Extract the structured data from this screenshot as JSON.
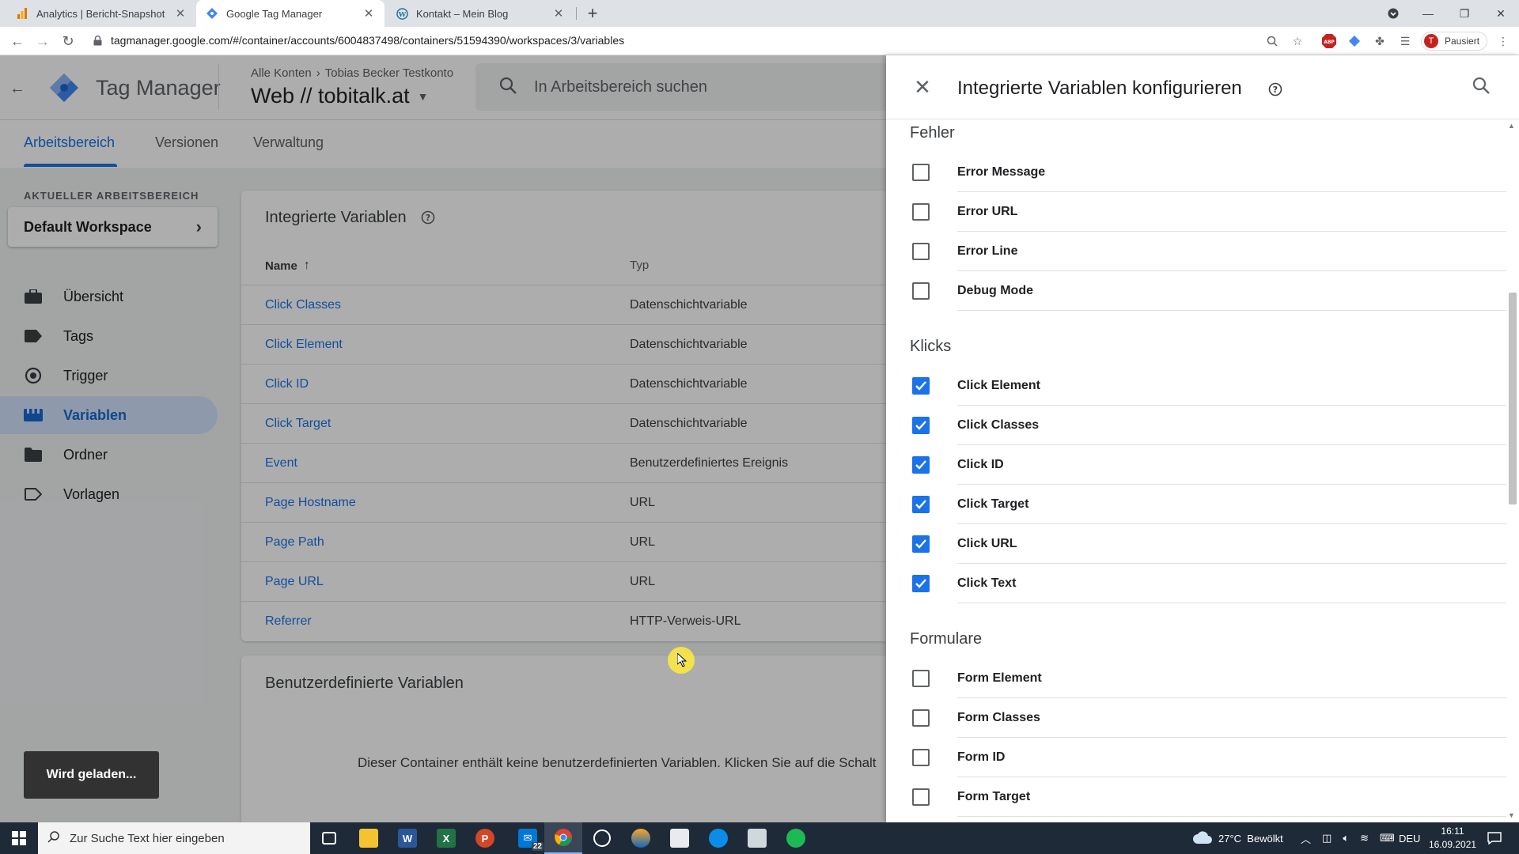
{
  "browser": {
    "tabs": [
      {
        "title": "Analytics | Bericht-Snapshot",
        "icon": "analytics-icon",
        "active": false
      },
      {
        "title": "Google Tag Manager",
        "icon": "gtm-icon",
        "active": true
      },
      {
        "title": "Kontakt – Mein Blog",
        "icon": "wordpress-icon",
        "active": false
      }
    ],
    "url": "tagmanager.google.com/#/container/accounts/6004837498/containers/51594390/workspaces/3/variables",
    "profile_label": "Pausiert",
    "profile_initial": "T"
  },
  "header": {
    "product": "Tag Manager",
    "breadcrumb_all": "Alle Konten",
    "breadcrumb_account": "Tobias Becker Testkonto",
    "container": "Web // tobitalk.at",
    "search_placeholder": "In Arbeitsbereich suchen"
  },
  "top_tabs": [
    "Arbeitsbereich",
    "Versionen",
    "Verwaltung"
  ],
  "workspace": {
    "label": "AKTUELLER ARBEITSBEREICH",
    "name": "Default Workspace"
  },
  "nav": [
    {
      "label": "Übersicht",
      "icon": "briefcase-icon",
      "active": false
    },
    {
      "label": "Tags",
      "icon": "tag-icon",
      "active": false
    },
    {
      "label": "Trigger",
      "icon": "trigger-icon",
      "active": false
    },
    {
      "label": "Variablen",
      "icon": "variables-icon",
      "active": true
    },
    {
      "label": "Ordner",
      "icon": "folder-icon",
      "active": false
    },
    {
      "label": "Vorlagen",
      "icon": "template-icon",
      "active": false
    }
  ],
  "builtin_card": {
    "title": "Integrierte Variablen",
    "col_name": "Name",
    "col_type": "Typ",
    "rows": [
      {
        "name": "Click Classes",
        "type": "Datenschichtvariable"
      },
      {
        "name": "Click Element",
        "type": "Datenschichtvariable"
      },
      {
        "name": "Click ID",
        "type": "Datenschichtvariable"
      },
      {
        "name": "Click Target",
        "type": "Datenschichtvariable"
      },
      {
        "name": "Event",
        "type": "Benutzerdefiniertes Ereignis"
      },
      {
        "name": "Page Hostname",
        "type": "URL"
      },
      {
        "name": "Page Path",
        "type": "URL"
      },
      {
        "name": "Page URL",
        "type": "URL"
      },
      {
        "name": "Referrer",
        "type": "HTTP-Verweis-URL"
      }
    ]
  },
  "custom_card": {
    "title": "Benutzerdefinierte Variablen",
    "empty_text": "Dieser Container enthält keine benutzerdefinierten Variablen. Klicken Sie auf die Schalt"
  },
  "toast": "Wird geladen...",
  "panel": {
    "title": "Integrierte Variablen konfigurieren",
    "sections": [
      {
        "title": "Fehler",
        "options": [
          {
            "label": "Error Message",
            "checked": false
          },
          {
            "label": "Error URL",
            "checked": false
          },
          {
            "label": "Error Line",
            "checked": false
          },
          {
            "label": "Debug Mode",
            "checked": false
          }
        ]
      },
      {
        "title": "Klicks",
        "options": [
          {
            "label": "Click Element",
            "checked": true
          },
          {
            "label": "Click Classes",
            "checked": true
          },
          {
            "label": "Click ID",
            "checked": true
          },
          {
            "label": "Click Target",
            "checked": true
          },
          {
            "label": "Click URL",
            "checked": true
          },
          {
            "label": "Click Text",
            "checked": true
          }
        ]
      },
      {
        "title": "Formulare",
        "options": [
          {
            "label": "Form Element",
            "checked": false
          },
          {
            "label": "Form Classes",
            "checked": false
          },
          {
            "label": "Form ID",
            "checked": false
          },
          {
            "label": "Form Target",
            "checked": false
          }
        ]
      }
    ]
  },
  "taskbar": {
    "search_placeholder": "Zur Suche Text hier eingeben",
    "mail_badge": "22",
    "weather": "27°C  Bewölkt",
    "language": "DEU",
    "time": "16:11",
    "date": "16.09.2021"
  },
  "colors": {
    "accent": "#1a73e8",
    "nav_active_bg": "#d2e3fc",
    "taskbar": "#1f2a38"
  }
}
